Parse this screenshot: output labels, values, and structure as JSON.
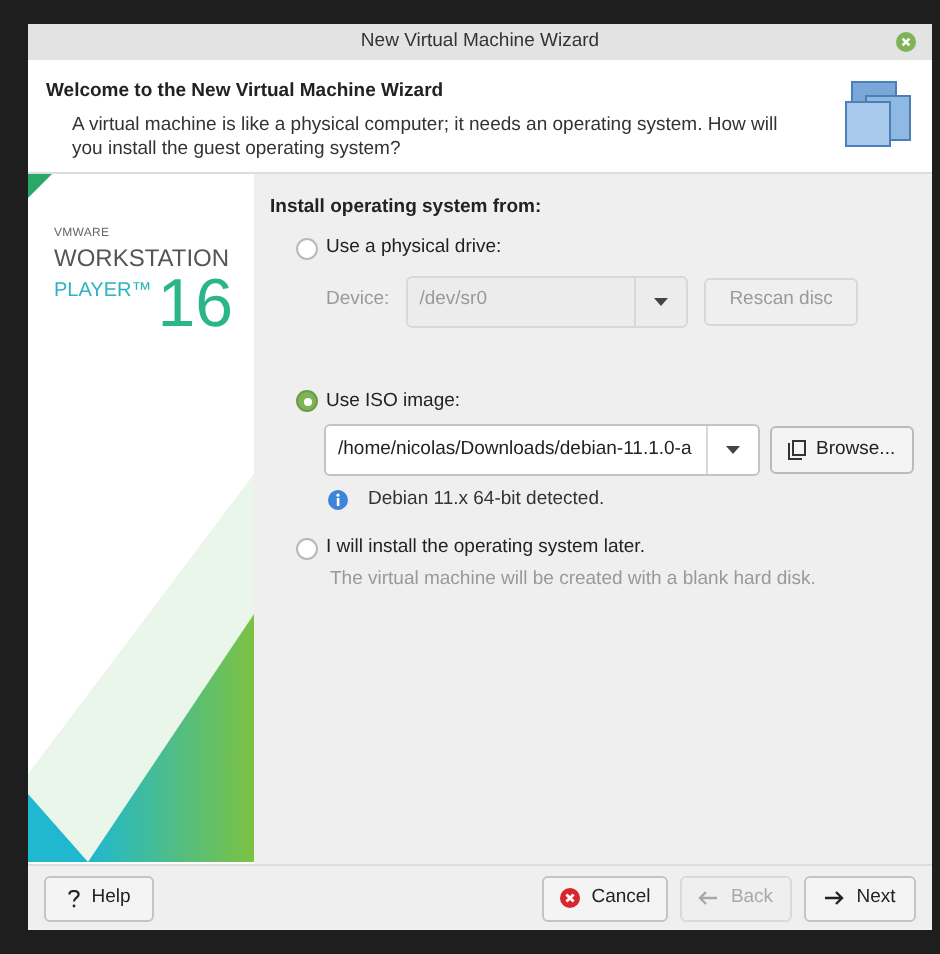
{
  "window": {
    "title": "New Virtual Machine Wizard"
  },
  "header": {
    "title": "Welcome to the New Virtual Machine Wizard",
    "description": "A virtual machine is like a physical computer; it needs an operating system. How will you install the guest operating system?"
  },
  "banner": {
    "brand": "VMWARE",
    "product": "WORKSTATION",
    "edition": "PLAYER™",
    "version": "16"
  },
  "section_title": "Install operating system from:",
  "options": [
    {
      "kind": "drive",
      "label": "Use a physical drive:",
      "selected": false,
      "field_label": "Device:",
      "value": "/dev/sr0",
      "disabled": true,
      "button": "Rescan disc"
    },
    {
      "kind": "iso",
      "label": "Use ISO image:",
      "selected": true,
      "value": "/home/nicolas/Downloads/debian-11.1.0-a",
      "disabled": false,
      "button": "Browse...",
      "info": "Debian 11.x 64-bit detected."
    },
    {
      "kind": "later",
      "label": "I will install the operating system later.",
      "selected": false,
      "note": "The virtual machine will be created with a blank hard disk."
    }
  ],
  "buttons": [
    {
      "kind": "help",
      "label": "Help",
      "disabled": false
    },
    {
      "kind": "cancel",
      "label": "Cancel",
      "disabled": false
    },
    {
      "kind": "back",
      "label": "Back",
      "disabled": true
    },
    {
      "kind": "next",
      "label": "Next",
      "disabled": false
    }
  ]
}
